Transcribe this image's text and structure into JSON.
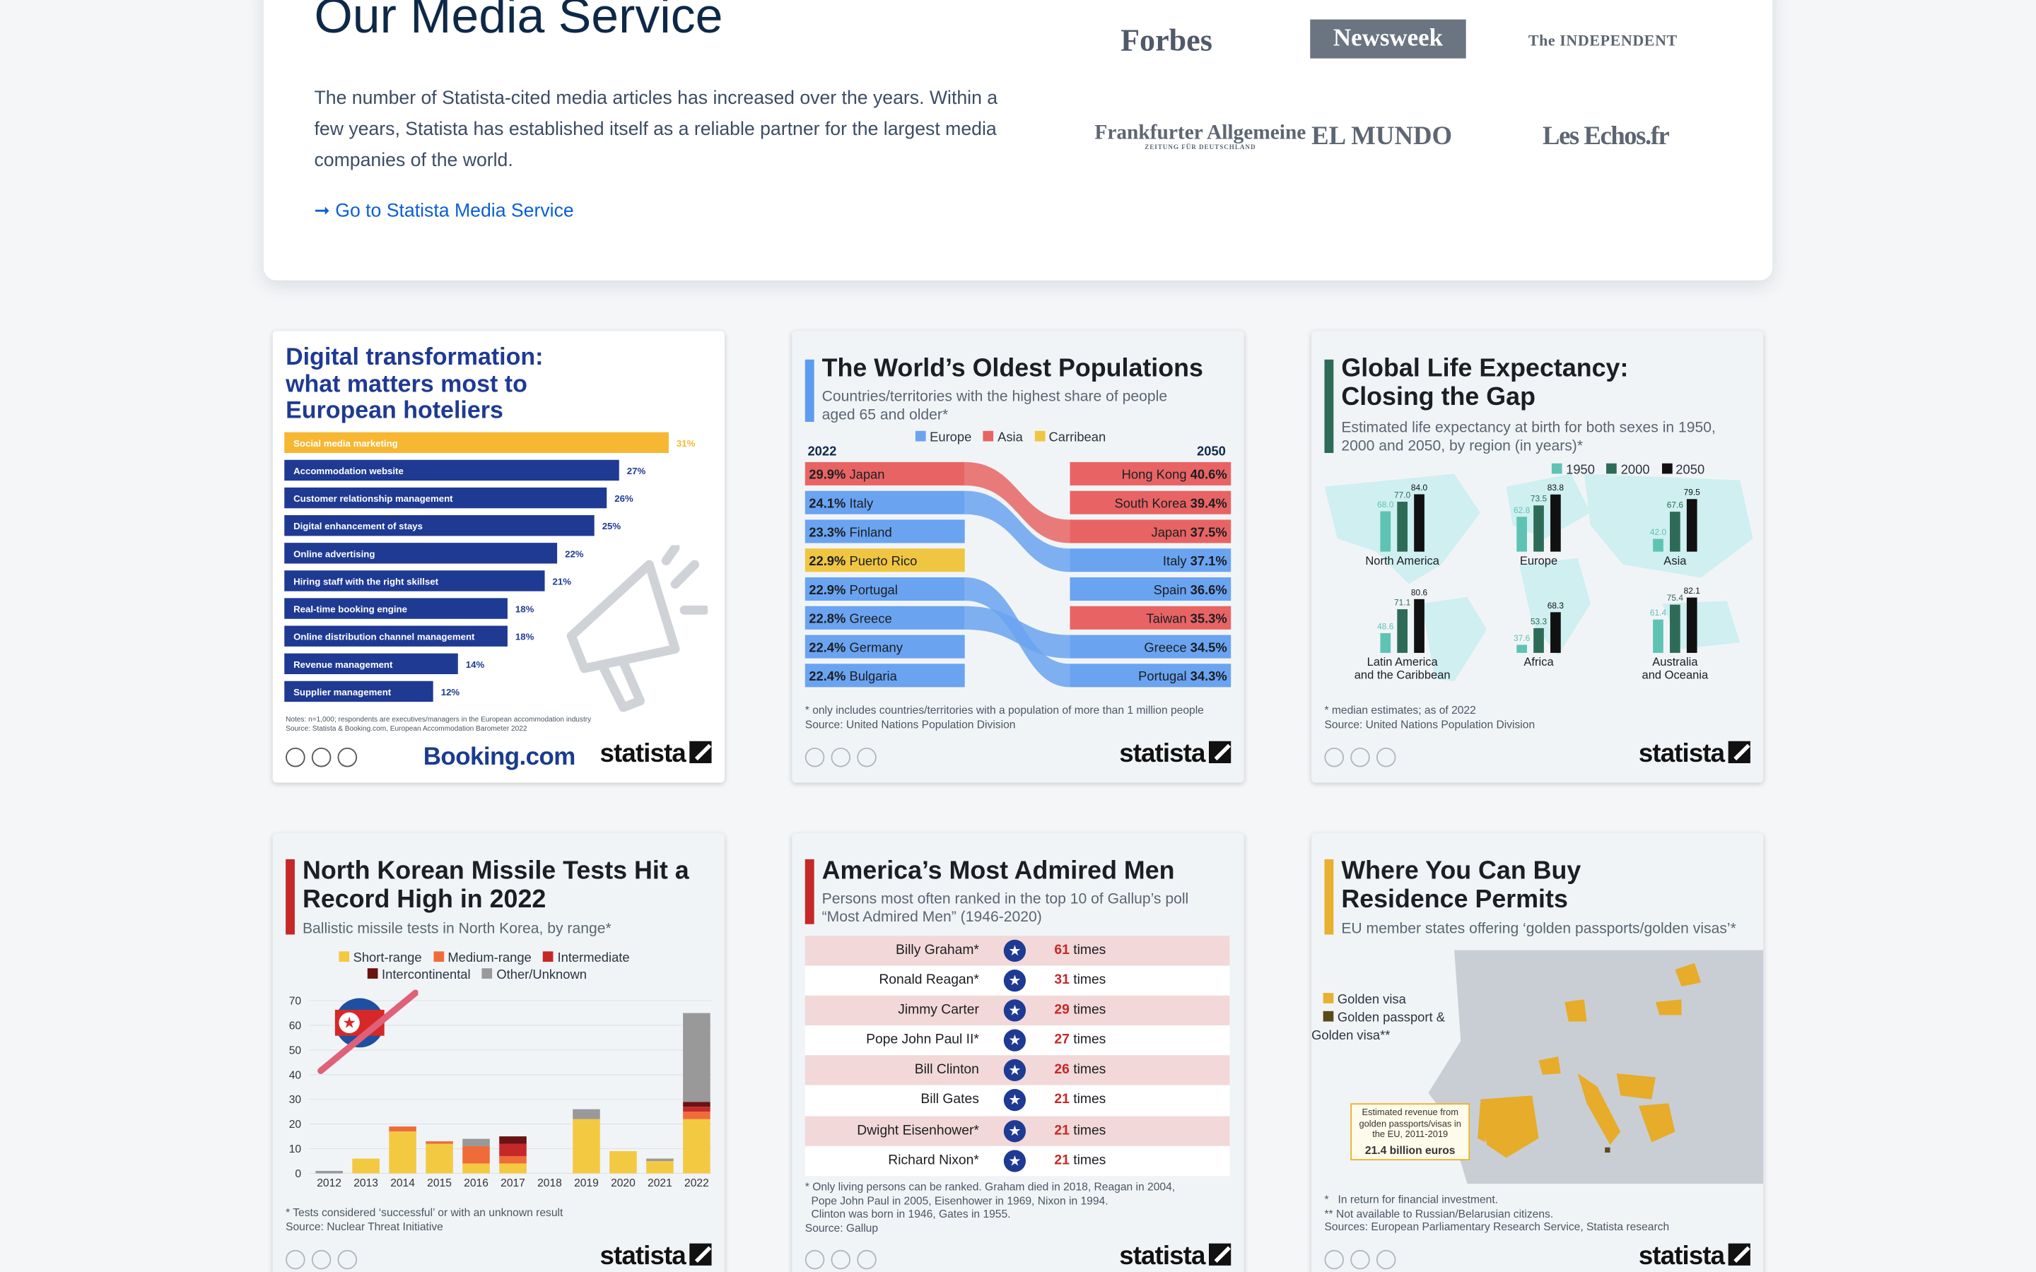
{
  "media": {
    "title": "Our Media Service",
    "desc": "The number of Statista-cited media articles has increased over the years. Within a few years, Statista has established itself as a reliable partner for the largest media companies of the world.",
    "link": "Go to Statista Media Service",
    "logos": [
      "Forbes",
      "Newsweek",
      "The INDEPENDENT",
      "Frankfurter Allgemeine",
      "EL MUNDO",
      "Les Echos.fr"
    ],
    "faz_sub": "ZEITUNG FÜR DEUTSCHLAND"
  },
  "cards": [
    {
      "title": "Digital transformation: what matters most to European hoteliers",
      "bars": [
        {
          "label": "Social media marketing",
          "value": 31
        },
        {
          "label": "Accommodation website",
          "value": 27
        },
        {
          "label": "Customer relationship management",
          "value": 26
        },
        {
          "label": "Digital enhancement of stays",
          "value": 25
        },
        {
          "label": "Online advertising",
          "value": 22
        },
        {
          "label": "Hiring staff with the right skillset",
          "value": 21
        },
        {
          "label": "Real-time booking engine",
          "value": 18
        },
        {
          "label": "Online distribution channel management",
          "value": 18
        },
        {
          "label": "Revenue management",
          "value": 14
        },
        {
          "label": "Supplier management",
          "value": 12
        }
      ],
      "note": "Notes: n=1,000; respondents are executives/managers in the European accommodation industry\nSource: Statista & Booking.com, European Accommodation Barometer 2022",
      "partner": "Booking.com",
      "accent": "#f7b733",
      "bar": "#1f3a93"
    },
    {
      "title": "The World’s Oldest Populations",
      "sub": "Countries/territories with the highest share of people aged 65 and older*",
      "legend": [
        "Europe",
        "Asia",
        "Carribean"
      ],
      "y1": "2022",
      "y2": "2050",
      "left": [
        {
          "v": "29.9%",
          "n": "Japan",
          "r": "asia"
        },
        {
          "v": "24.1%",
          "n": "Italy",
          "r": "eu"
        },
        {
          "v": "23.3%",
          "n": "Finland",
          "r": "eu"
        },
        {
          "v": "22.9%",
          "n": "Puerto Rico",
          "r": "car"
        },
        {
          "v": "22.9%",
          "n": "Portugal",
          "r": "eu"
        },
        {
          "v": "22.8%",
          "n": "Greece",
          "r": "eu"
        },
        {
          "v": "22.4%",
          "n": "Germany",
          "r": "eu"
        },
        {
          "v": "22.4%",
          "n": "Bulgaria",
          "r": "eu"
        }
      ],
      "right": [
        {
          "v": "40.6%",
          "n": "Hong Kong",
          "r": "asia"
        },
        {
          "v": "39.4%",
          "n": "South Korea",
          "r": "asia"
        },
        {
          "v": "37.5%",
          "n": "Japan",
          "r": "asia"
        },
        {
          "v": "37.1%",
          "n": "Italy",
          "r": "eu"
        },
        {
          "v": "36.6%",
          "n": "Spain",
          "r": "eu"
        },
        {
          "v": "35.3%",
          "n": "Taiwan",
          "r": "asia"
        },
        {
          "v": "34.5%",
          "n": "Greece",
          "r": "eu"
        },
        {
          "v": "34.3%",
          "n": "Portugal",
          "r": "eu"
        }
      ],
      "note": "* only includes countries/territories with a population of more than 1 million people\nSource: United Nations Population Division",
      "accent": "#5b9bf0"
    },
    {
      "title": "Global Life Expectancy: Closing the Gap",
      "sub": "Estimated life expectancy at birth for both sexes in 1950, 2000 and 2050, by region (in years)*",
      "legend": [
        "1950",
        "2000",
        "2050"
      ],
      "regions": [
        {
          "name": "North America",
          "v": [
            68.0,
            77.0,
            84.0
          ]
        },
        {
          "name": "Europe",
          "v": [
            62.8,
            73.5,
            83.8
          ]
        },
        {
          "name": "Asia",
          "v": [
            42.0,
            67.6,
            79.5
          ]
        },
        {
          "name": "Latin America\nand the Caribbean",
          "v": [
            48.6,
            71.1,
            80.6
          ]
        },
        {
          "name": "Africa",
          "v": [
            37.6,
            53.3,
            68.3
          ]
        },
        {
          "name": "Australia\nand Oceania",
          "v": [
            61.4,
            75.4,
            82.1
          ]
        }
      ],
      "note": "* median estimates; as of 2022\nSource: United Nations Population Division",
      "accent": "#2e6b57"
    },
    {
      "title": "North Korean Missile Tests Hit a Record High in 2022",
      "sub": "Ballistic missile tests in North Korea, by range*",
      "legend": [
        "Short-range",
        "Medium-range",
        "Intermediate",
        "Intercontinental",
        "Other/Unknown"
      ],
      "years": [
        "2012",
        "2013",
        "2014",
        "2015",
        "2016",
        "2017",
        "2018",
        "2019",
        "2020",
        "2021",
        "2022"
      ],
      "yticks": [
        "0",
        "10",
        "20",
        "30",
        "40",
        "50",
        "60",
        "70"
      ],
      "series": [
        {
          "name": "Short-range",
          "values": [
            0,
            6,
            17,
            12,
            4,
            4,
            0,
            22,
            9,
            5,
            22
          ]
        },
        {
          "name": "Medium-range",
          "values": [
            0,
            0,
            2,
            1,
            7,
            3,
            0,
            0,
            0,
            0,
            3
          ]
        },
        {
          "name": "Intermediate",
          "values": [
            0,
            0,
            0,
            0,
            0,
            5,
            0,
            0,
            0,
            0,
            2
          ]
        },
        {
          "name": "Intercontinental",
          "values": [
            0,
            0,
            0,
            0,
            0,
            3,
            0,
            0,
            0,
            0,
            2
          ]
        },
        {
          "name": "Other/Unknown",
          "values": [
            1,
            0,
            0,
            0,
            3,
            0,
            0,
            4,
            0,
            1,
            36
          ]
        }
      ],
      "note": "* Tests considered ‘successful’ or with an unknown result\nSource: Nuclear Threat Initiative",
      "accent": "#c62828"
    },
    {
      "title": "America’s Most Admired Men",
      "sub": "Persons most often ranked in the top 10 of Gallup’s poll “Most Admired Men” (1946-2020)",
      "rows": [
        {
          "n": "Billy Graham*",
          "v": "61",
          "t": "times"
        },
        {
          "n": "Ronald Reagan*",
          "v": "31",
          "t": "times"
        },
        {
          "n": "Jimmy Carter",
          "v": "29",
          "t": "times"
        },
        {
          "n": "Pope John Paul II*",
          "v": "27",
          "t": "times"
        },
        {
          "n": "Bill Clinton",
          "v": "26",
          "t": "times"
        },
        {
          "n": "Bill Gates",
          "v": "21",
          "t": "times"
        },
        {
          "n": "Dwight Eisenhower*",
          "v": "21",
          "t": "times"
        },
        {
          "n": "Richard Nixon*",
          "v": "21",
          "t": "times"
        }
      ],
      "note": "* Only living persons can be ranked. Graham died in 2018, Reagan in 2004,\n  Pope John Paul in 2005, Eisenhower in 1969, Nixon in 1994.\n  Clinton was born in 1946, Gates in 1955.\nSource: Gallup",
      "accent": "#c62828"
    },
    {
      "title": "Where You Can Buy Residence Permits",
      "sub": "EU member states offering ‘golden passports/golden visas’*",
      "legend": [
        "Golden visa",
        "Golden passport & Golden visa**"
      ],
      "callout": "Estimated revenue from golden passports/visas in the EU, 2011-2019",
      "callout_value": "21.4 billion euros",
      "note": "*   In return for financial investment.\n** Not available to Russian/Belarusian citizens.\nSources: European Parliamentary Research Service, Statista research",
      "accent": "#e6b12e"
    }
  ],
  "brand": "statista"
}
